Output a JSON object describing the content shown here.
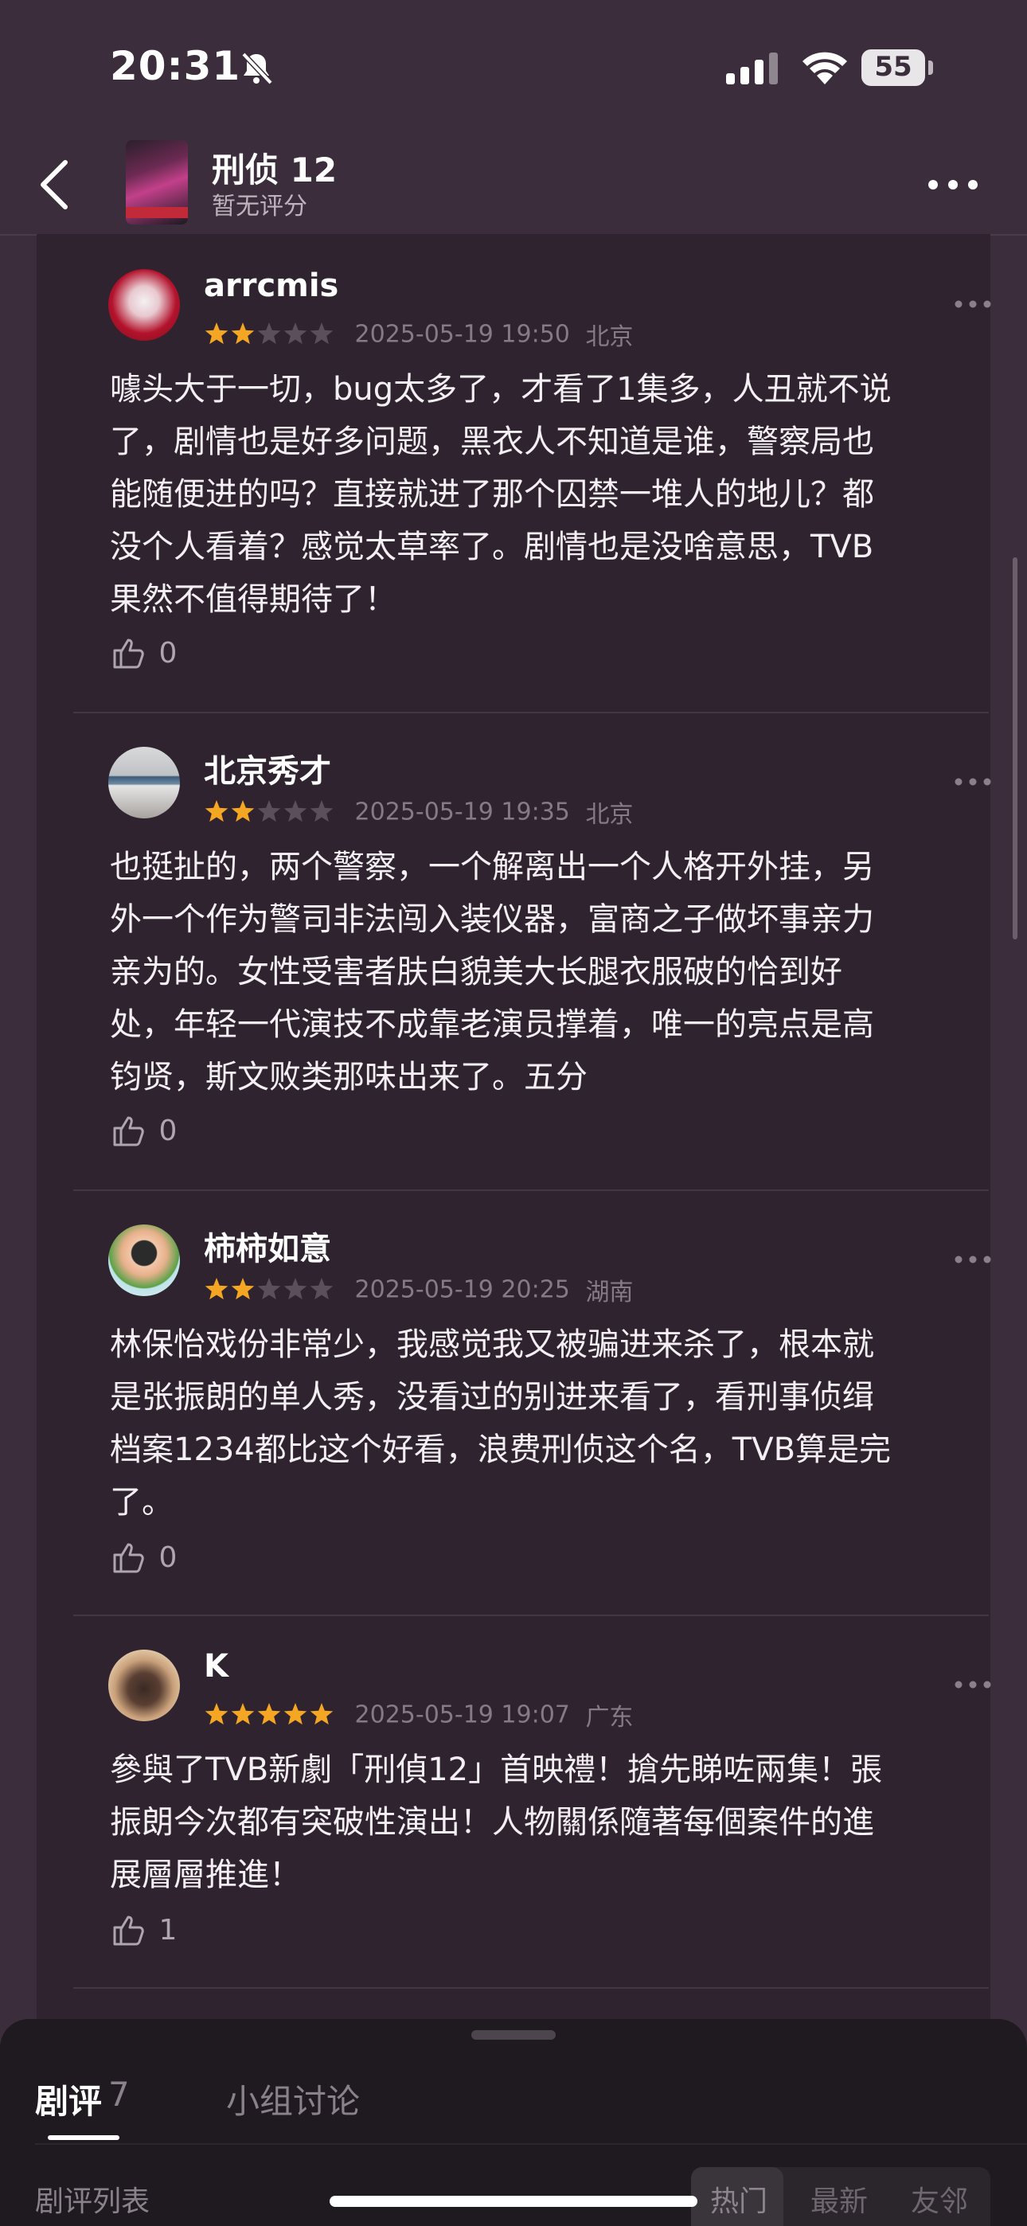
{
  "status_bar": {
    "time": "20:31",
    "battery": "55"
  },
  "header": {
    "title": "刑侦 12",
    "rating_text": "暂无评分"
  },
  "reviews": [
    {
      "author": "arrcmis",
      "stars": 2,
      "date": "2025-05-19 19:50",
      "location": "北京",
      "lines": [
        "噱头大于一切，bug太多了，才看了1集多，人丑就不说",
        "了，剧情也是好多问题，黑衣人不知道是谁，警察局也",
        "能随便进的吗？直接就进了那个囚禁一堆人的地儿？都",
        "没个人看着？感觉太草率了。剧情也是没啥意思，TVB",
        "果然不值得期待了！"
      ],
      "likes": "0"
    },
    {
      "author": "北京秀才",
      "stars": 2,
      "date": "2025-05-19 19:35",
      "location": "北京",
      "lines": [
        "也挺扯的，两个警察，一个解离出一个人格开外挂，另",
        "外一个作为警司非法闯入装仪器，富商之子做坏事亲力",
        "亲为的。女性受害者肤白貌美大长腿衣服破的恰到好",
        "处，年轻一代演技不成靠老演员撑着，唯一的亮点是高",
        "钧贤，斯文败类那味出来了。五分"
      ],
      "likes": "0"
    },
    {
      "author": "柿柿如意",
      "stars": 2,
      "date": "2025-05-19 20:25",
      "location": "湖南",
      "lines": [
        "林保怡戏份非常少，我感觉我又被骗进来杀了，根本就",
        "是张振朗的单人秀，没看过的别进来看了，看刑事侦缉",
        "档案1234都比这个好看，浪费刑侦这个名，TVB算是完",
        "了。"
      ],
      "likes": "0"
    },
    {
      "author": "K",
      "stars": 5,
      "date": "2025-05-19 19:07",
      "location": "广东",
      "lines": [
        "參與了TVB新劇「刑偵12」首映禮！搶先睇咗兩集！張",
        "振朗今次都有突破性演出！人物關係隨著每個案件的進",
        "展層層推進！"
      ],
      "likes": "1"
    }
  ],
  "bottom_panel": {
    "tab_reviews": "剧评",
    "tab_reviews_count": "7",
    "tab_group": "小组讨论",
    "list_label": "剧评列表",
    "sort_options": [
      "热门",
      "最新",
      "友邻"
    ]
  },
  "colors": {
    "star_filled": "#f5a623",
    "star_empty": "#5a4f5b",
    "background": "#3b2d3c",
    "card": "#2e232f"
  }
}
